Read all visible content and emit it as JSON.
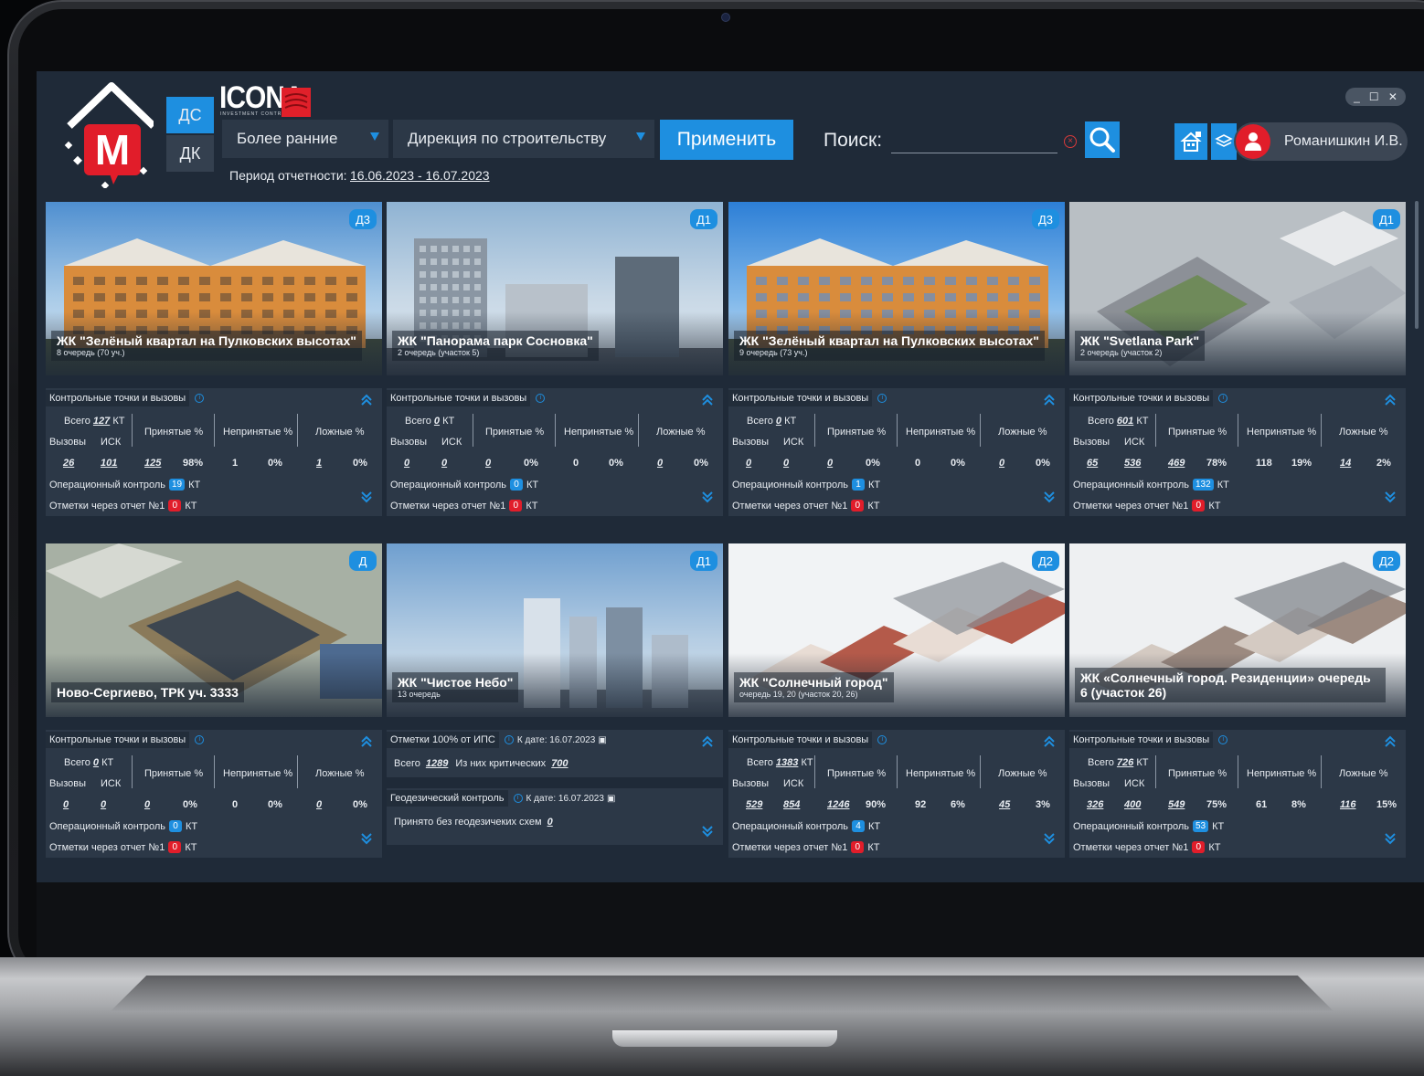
{
  "header": {
    "mode_tabs": [
      {
        "label": "ДС",
        "active": true
      },
      {
        "label": "ДК",
        "active": false
      }
    ],
    "brand": "ICONA",
    "brand_sub": "INVESTMENT CONTROL",
    "period_select": "Более ранние",
    "direction_select": "Дирекция по строительству",
    "apply_label": "Применить",
    "search_label": "Поиск:",
    "search_value": "",
    "period_label": "Период отчетности:",
    "period_value": "16.06.2023 - 16.07.2023",
    "user_name": "Романишкин И.В."
  },
  "colors": {
    "accent": "#1e8fe0",
    "danger": "#e11d2a",
    "panel": "#2c3847",
    "background": "#1f2a38"
  },
  "labels": {
    "kt_header": "Контрольные точки и вызовы",
    "total": "Всего",
    "kt": "КТ",
    "calls": "Вызовы",
    "isk": "ИСК",
    "accepted": "Принятые %",
    "rejected": "Непринятые %",
    "false": "Ложные %",
    "op_control": "Операционный контроль",
    "marks": "Отметки через отчет №1"
  },
  "cards": [
    {
      "title": "ЖК \"Зелёный квартал на Пулковских высотах\"",
      "subtitle": "8 очередь (70 уч.)",
      "badge": "Д3",
      "total": "127",
      "calls": "26",
      "isk": "101",
      "accepted": "125",
      "accepted_pct": "98%",
      "rejected": "1",
      "rejected_pct": "0%",
      "false_n": "1",
      "false_pct": "0%",
      "op": "19",
      "marks": "0"
    },
    {
      "title": "ЖК \"Панорама парк Сосновка\"",
      "subtitle": "2 очередь (участок 5)",
      "badge": "Д1",
      "total": "0",
      "calls": "0",
      "isk": "0",
      "accepted": "0",
      "accepted_pct": "0%",
      "rejected": "0",
      "rejected_pct": "0%",
      "false_n": "0",
      "false_pct": "0%",
      "op": "0",
      "marks": "0"
    },
    {
      "title": "ЖК \"Зелёный квартал на Пулковских высотах\"",
      "subtitle": "9 очередь (73 уч.)",
      "badge": "Д3",
      "total": "0",
      "calls": "0",
      "isk": "0",
      "accepted": "0",
      "accepted_pct": "0%",
      "rejected": "0",
      "rejected_pct": "0%",
      "false_n": "0",
      "false_pct": "0%",
      "op": "1",
      "marks": "0"
    },
    {
      "title": "ЖК \"Svetlana Park\"",
      "subtitle": "2 очередь (участок 2)",
      "badge": "Д1",
      "total": "601",
      "calls": "65",
      "isk": "536",
      "accepted": "469",
      "accepted_pct": "78%",
      "rejected": "118",
      "rejected_pct": "19%",
      "false_n": "14",
      "false_pct": "2%",
      "op": "132",
      "marks": "0"
    },
    {
      "title": "Ново-Сергиево, ТРК уч. 3333",
      "subtitle": "",
      "badge": "Д",
      "total": "0",
      "calls": "0",
      "isk": "0",
      "accepted": "0",
      "accepted_pct": "0%",
      "rejected": "0",
      "rejected_pct": "0%",
      "false_n": "0",
      "false_pct": "0%",
      "op": "0",
      "marks": "0"
    },
    {
      "title": "ЖК \"Чистое Небо\"",
      "subtitle": "13 очередь",
      "badge": "Д1",
      "ips_label": "Отметки 100% от ИПС",
      "ips_date_label": "К дате: 16.07.2023",
      "ips_total_label": "Всего",
      "ips_total": "1289",
      "ips_critical_label": "Из них критических",
      "ips_critical": "700",
      "geo_label": "Геодезический контроль",
      "geo_date_label": "К дате: 16.07.2023",
      "geo_row_label": "Принято без геодезичеких схем",
      "geo_value": "0"
    },
    {
      "title": "ЖК \"Солнечный город\"",
      "subtitle": "очередь 19, 20 (участок 20, 26)",
      "badge": "Д2",
      "total": "1383",
      "calls": "529",
      "isk": "854",
      "accepted": "1246",
      "accepted_pct": "90%",
      "rejected": "92",
      "rejected_pct": "6%",
      "false_n": "45",
      "false_pct": "3%",
      "op": "4",
      "marks": "0"
    },
    {
      "title": "ЖК «Солнечный город. Резиденции» очередь 6 (участок 26)",
      "subtitle": "",
      "badge": "Д2",
      "total": "726",
      "calls": "326",
      "isk": "400",
      "accepted": "549",
      "accepted_pct": "75%",
      "rejected": "61",
      "rejected_pct": "8%",
      "false_n": "116",
      "false_pct": "15%",
      "op": "53",
      "marks": "0"
    }
  ]
}
